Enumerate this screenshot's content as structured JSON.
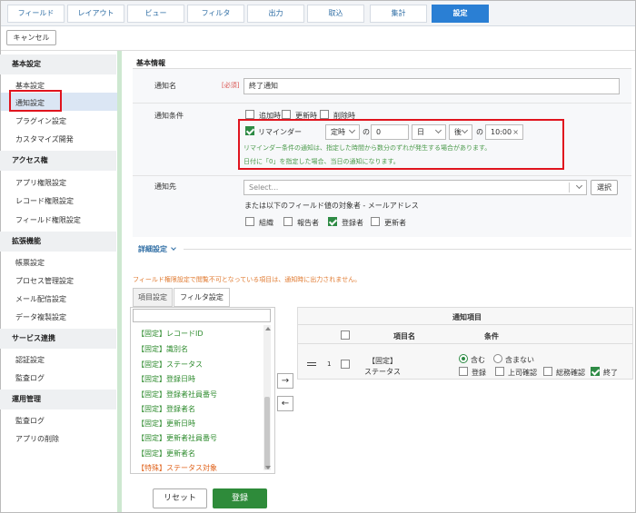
{
  "tabs": [
    {
      "label": "フィールド"
    },
    {
      "label": "レイアウト"
    },
    {
      "label": "ビュー"
    },
    {
      "label": "フィルタ"
    },
    {
      "label": "出力"
    },
    {
      "label": "取込"
    },
    {
      "label": "集計"
    },
    {
      "label": "設定"
    }
  ],
  "toolbar": {
    "cancel_label": "キャンセル"
  },
  "sidebar": {
    "sections": [
      {
        "title": "基本設定",
        "items": [
          "基本設定",
          "通知設定",
          "プラグイン設定",
          "カスタマイズ開発"
        ]
      },
      {
        "title": "アクセス権",
        "items": [
          "アプリ権限設定",
          "レコード権限設定",
          "フィールド権限設定"
        ]
      },
      {
        "title": "拡張機能",
        "items": [
          "帳票設定",
          "プロセス管理設定",
          "メール配信設定",
          "データ複製設定"
        ]
      },
      {
        "title": "サービス連携",
        "items": [
          "認証設定",
          "監査ログ"
        ]
      },
      {
        "title": "運用管理",
        "items": [
          "監査ログ",
          "アプリの削除"
        ]
      }
    ]
  },
  "main": {
    "section_title": "基本情報",
    "name_label": "通知名",
    "required_label": "[必須]",
    "name_value": "終了通知",
    "condition_label": "通知条件",
    "conditions": [
      "追加時",
      "更新時",
      "削除時"
    ],
    "reminder_label": "リマインダー",
    "reminder": {
      "field": "定時",
      "no1": "の",
      "days": "0",
      "unit": "日",
      "when": "後",
      "no2": "の",
      "time": "10:00"
    },
    "note1": "リマインダー条件の通知は、指定した時間から数分のずれが発生する場合があります。",
    "note2": "日付に「0」を指定した場合、当日の通知になります。",
    "dest_label": "通知先",
    "dest_placeholder": "Select...",
    "dest_select_btn": "選択",
    "dest_field_text": "または以下のフィールド値の対象者 - メールアドレス",
    "dest_fields": [
      "組織",
      "報告者",
      "登録者",
      "更新者"
    ],
    "advanced_label": "詳細設定",
    "perm_note": "フィールド権限設定で閲覧不可となっている項目は、通知時に出力されません。",
    "subtabs": [
      "項目設定",
      "フィルタ設定"
    ],
    "fields_list": [
      "【固定】レコードID",
      "【固定】識別名",
      "【固定】ステータス",
      "【固定】登録日時",
      "【固定】登録者社員番号",
      "【固定】登録者名",
      "【固定】更新日時",
      "【固定】更新者社員番号",
      "【固定】更新者名",
      "【特殊】ステータス対象"
    ],
    "notify_table": {
      "title": "通知項目",
      "col_name": "項目名",
      "col_cond": "条件",
      "row_num": "1",
      "row_name_1": "【固定】",
      "row_name_2": "ステータス",
      "include": "含む",
      "exclude": "含まない",
      "statuses": [
        "登録",
        "上司確認",
        "総務確認",
        "終了"
      ]
    },
    "reset_label": "リセット",
    "register_label": "登録"
  },
  "arrows": {
    "right": "→",
    "left": "←"
  },
  "colors": {
    "accent": "#2a7fd4",
    "green": "#2e8b3a",
    "highlight": "#e0141e"
  }
}
